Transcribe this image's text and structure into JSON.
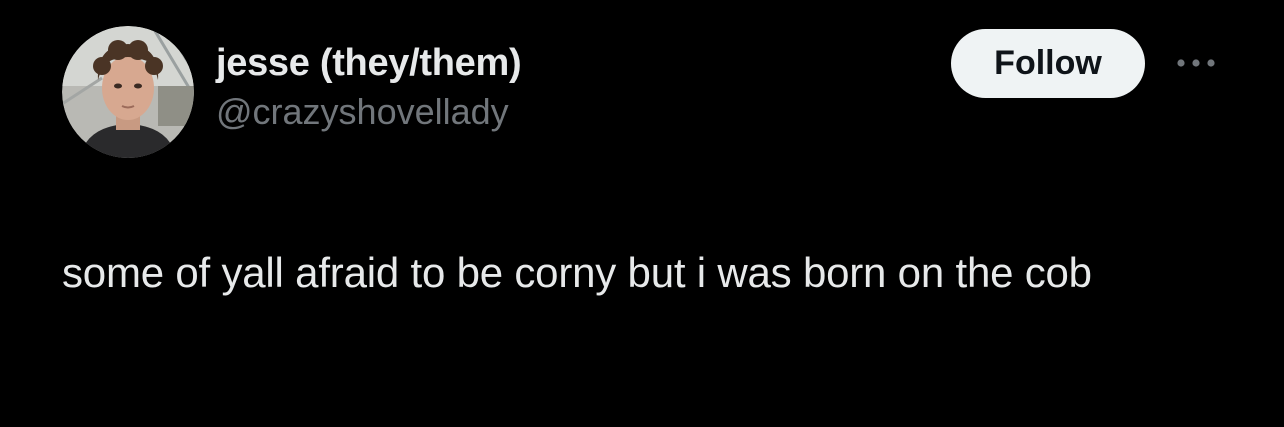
{
  "author": {
    "display_name": "jesse (they/them)",
    "handle": "@crazyshovellady"
  },
  "actions": {
    "follow_label": "Follow"
  },
  "icons": {
    "more": "more-horizontal-icon"
  },
  "tweet": {
    "text": "some of yall afraid to be corny but i was born on the cob"
  },
  "colors": {
    "background": "#000000",
    "text_primary": "#e7e9ea",
    "text_secondary": "#71767b",
    "button_bg": "#eff3f4",
    "button_text": "#0f1419"
  }
}
